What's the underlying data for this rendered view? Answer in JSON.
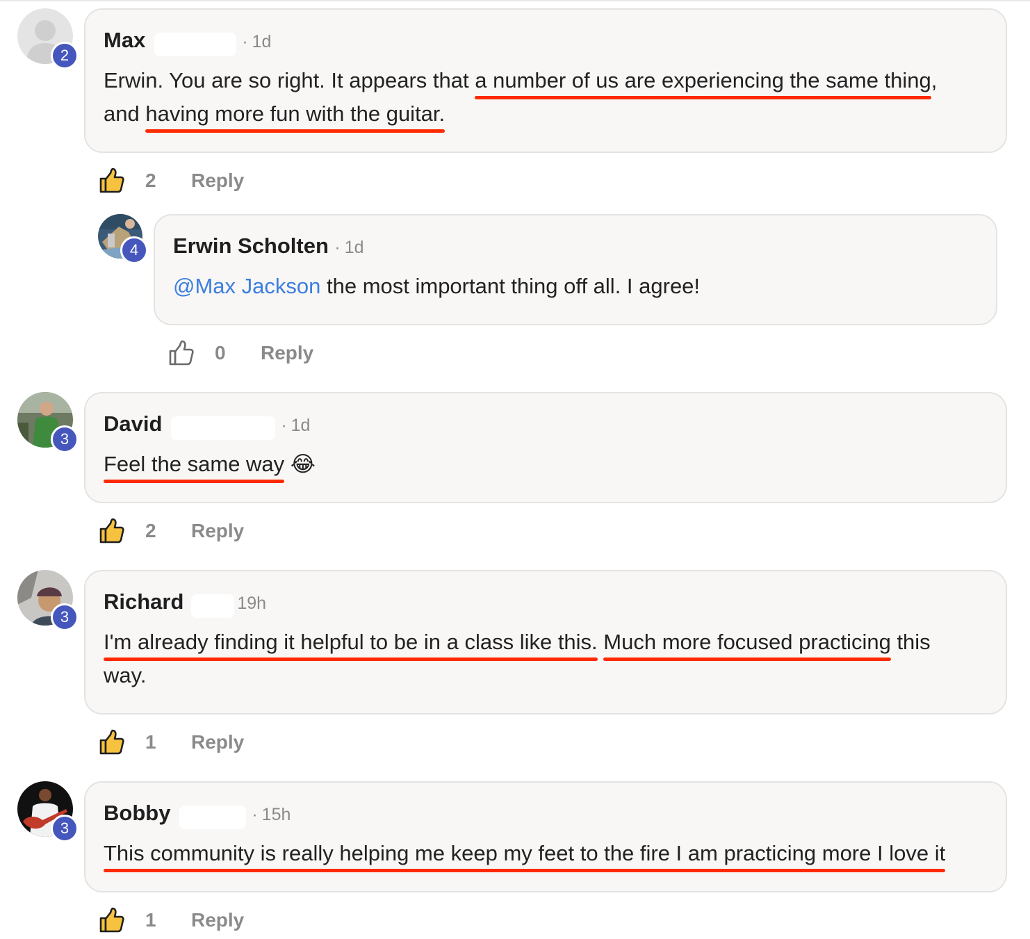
{
  "comments": [
    {
      "name": "Max",
      "time": "1d",
      "badge": "2",
      "text_plain1": "Erwin. You are so right. It appears that ",
      "text_ul1": "a number of us are experiencing the same thing",
      "text_plain2": ",",
      "text_plain3": "and ",
      "text_ul2": "having more fun with the guitar.",
      "likes": "2",
      "reply_label": "Reply",
      "liked": true
    },
    {
      "name": "Erwin Scholten",
      "time": "1d",
      "badge": "4",
      "mention": "@Max Jackson",
      "text": " the most important thing off all. I agree!",
      "likes": "0",
      "reply_label": "Reply",
      "liked": false
    },
    {
      "name": "David",
      "time": "1d",
      "badge": "3",
      "text_ul1": "Feel the same way",
      "emoji": "😂",
      "likes": "2",
      "reply_label": "Reply",
      "liked": true
    },
    {
      "name": "Richard",
      "time": "19h",
      "badge": "3",
      "text_ul1": "I'm already finding it helpful to be in a class like this.",
      "text_plain1": " ",
      "text_ul2": "Much more focused practicing",
      "text_plain2": " this",
      "text_plain3": "way.",
      "likes": "1",
      "reply_label": "Reply",
      "liked": true
    },
    {
      "name": "Bobby",
      "time": "15h",
      "badge": "3",
      "text_ul1": "This community is really helping me keep my feet to the fire I am practicing more I love it",
      "likes": "1",
      "reply_label": "Reply",
      "liked": true
    }
  ],
  "colors": {
    "accent": "#4557bd",
    "mention": "#3c7ee0",
    "underline": "#ff2a00",
    "like_fill": "#f7c23f",
    "bubble": "#f8f7f6"
  }
}
